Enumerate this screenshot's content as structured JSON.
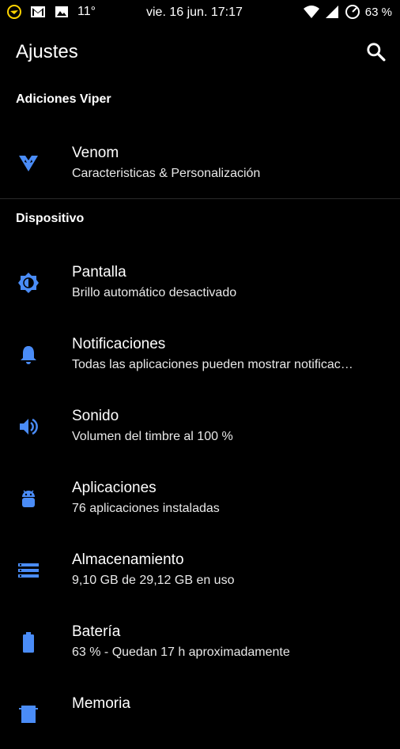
{
  "status_bar": {
    "temperature": "11°",
    "datetime": "vie. 16 jun. 17:17",
    "battery": "63 %",
    "left_icons": [
      "viper-notification-icon",
      "gmail-icon",
      "image-icon"
    ],
    "right_icons": [
      "wifi-icon",
      "signal-icon",
      "speedometer-icon"
    ]
  },
  "toolbar": {
    "title": "Ajustes",
    "search_icon": "search-icon"
  },
  "sections": [
    {
      "header": "Adiciones Viper",
      "items": [
        {
          "title": "Venom",
          "summary": "Caracteristicas & Personalización",
          "icon": "venom-icon"
        }
      ]
    },
    {
      "header": "Dispositivo",
      "items": [
        {
          "title": "Pantalla",
          "summary": "Brillo automático desactivado",
          "icon": "brightness-icon"
        },
        {
          "title": "Notificaciones",
          "summary": "Todas las aplicaciones pueden mostrar notificac…",
          "icon": "bell-icon"
        },
        {
          "title": "Sonido",
          "summary": "Volumen del timbre al 100 %",
          "icon": "volume-icon"
        },
        {
          "title": "Aplicaciones",
          "summary": "76 aplicaciones instaladas",
          "icon": "android-icon"
        },
        {
          "title": "Almacenamiento",
          "summary": "9,10 GB de 29,12 GB en uso",
          "icon": "storage-icon"
        },
        {
          "title": "Batería",
          "summary": "63 % - Quedan 17 h aproximadamente",
          "icon": "battery-icon"
        },
        {
          "title": "Memoria",
          "summary": "",
          "icon": "memory-icon"
        }
      ]
    }
  ],
  "colors": {
    "background": "#000000",
    "accent": "#4a8cf7",
    "text": "#ffffff"
  }
}
